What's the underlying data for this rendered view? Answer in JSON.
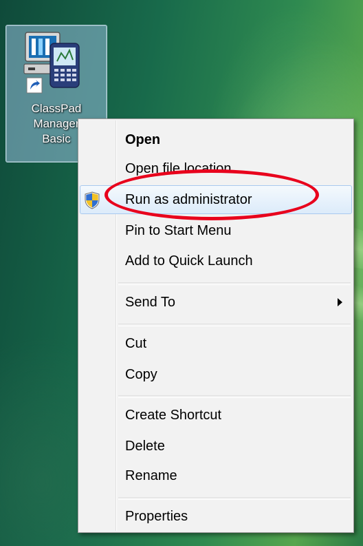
{
  "desktop_icon": {
    "label_lines": [
      "ClassPad",
      "Manager",
      "Basic"
    ],
    "icon": "classpad-manager-shortcut-icon"
  },
  "context_menu": {
    "items": [
      {
        "label": "Open",
        "bold": true
      },
      {
        "label": "Open file location"
      },
      {
        "label": "Run as administrator",
        "highlighted": true,
        "icon": "uac-shield-icon"
      },
      {
        "label": "Pin to Start Menu"
      },
      {
        "label": "Add to Quick Launch"
      },
      {
        "label": "Send To",
        "submenu": true
      },
      {
        "label": "Cut"
      },
      {
        "label": "Copy"
      },
      {
        "label": "Create Shortcut"
      },
      {
        "label": "Delete"
      },
      {
        "label": "Rename"
      },
      {
        "label": "Properties"
      }
    ]
  },
  "annotation": {
    "shape": "ellipse",
    "color": "#e8001c",
    "target": "Run as administrator"
  }
}
